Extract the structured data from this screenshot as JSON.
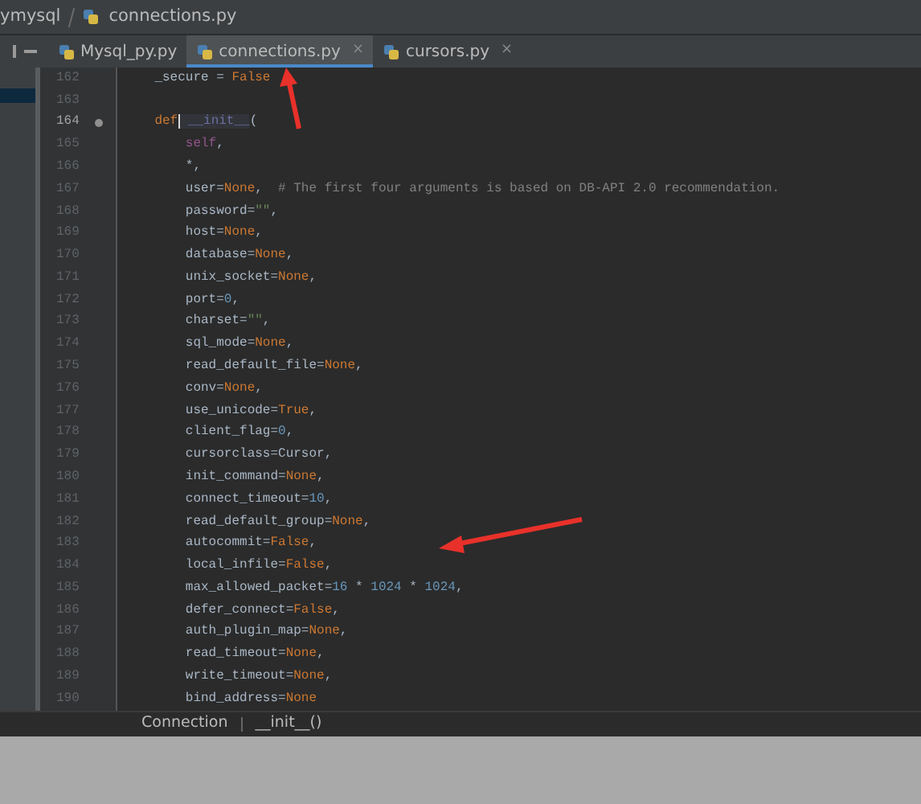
{
  "breadcrumb": [
    {
      "label": "ymysql",
      "kind": "package"
    },
    {
      "label": "connections.py",
      "kind": "file"
    }
  ],
  "tabs": [
    {
      "label": "Mysql_py.py",
      "selected": false
    },
    {
      "label": "connections.py",
      "selected": true,
      "close_glyph": "×"
    },
    {
      "label": "cursors.py",
      "selected": false,
      "close_glyph": "×"
    }
  ],
  "code_lines": [
    {
      "number": "162",
      "current": false,
      "segments": [
        {
          "text": "    _secure = ",
          "kind": "plain"
        },
        {
          "text": "False",
          "kind": "keyword"
        }
      ]
    },
    {
      "number": "163",
      "current": false
    },
    {
      "number": "164",
      "current": true,
      "caret": true,
      "segments": [
        {
          "text": "    def",
          "kind": "keyword"
        },
        {
          "text": " __init__",
          "kind": "function"
        },
        {
          "text": "(",
          "kind": "plain"
        }
      ]
    },
    {
      "number": "165",
      "current": false,
      "segments": [
        {
          "text": "        self",
          "kind": "self"
        },
        {
          "text": ",",
          "kind": "plain"
        }
      ]
    },
    {
      "number": "166",
      "current": false,
      "segments": [
        {
          "text": "        *,",
          "kind": "plain"
        }
      ]
    },
    {
      "number": "167",
      "current": false,
      "segments": [
        {
          "text": "        user=",
          "kind": "plain"
        },
        {
          "text": "None",
          "kind": "keyword"
        },
        {
          "text": ",  ",
          "kind": "plain"
        },
        {
          "text": "# The first four arguments is based on DB-API 2.0 recommendation.",
          "kind": "comment"
        }
      ]
    },
    {
      "number": "168",
      "current": false,
      "segments": [
        {
          "text": "        password=",
          "kind": "plain"
        },
        {
          "text": "\"\"",
          "kind": "string"
        },
        {
          "text": ",",
          "kind": "plain"
        }
      ]
    },
    {
      "number": "169",
      "current": false,
      "segments": [
        {
          "text": "        host=",
          "kind": "plain"
        },
        {
          "text": "None",
          "kind": "keyword"
        },
        {
          "text": ",",
          "kind": "plain"
        }
      ]
    },
    {
      "number": "170",
      "current": false,
      "segments": [
        {
          "text": "        database=",
          "kind": "plain"
        },
        {
          "text": "None",
          "kind": "keyword"
        },
        {
          "text": ",",
          "kind": "plain"
        }
      ]
    },
    {
      "number": "171",
      "current": false,
      "segments": [
        {
          "text": "        unix_socket=",
          "kind": "plain"
        },
        {
          "text": "None",
          "kind": "keyword"
        },
        {
          "text": ",",
          "kind": "plain"
        }
      ]
    },
    {
      "number": "172",
      "current": false,
      "segments": [
        {
          "text": "        port=",
          "kind": "plain"
        },
        {
          "text": "0",
          "kind": "number"
        },
        {
          "text": ",",
          "kind": "plain"
        }
      ]
    },
    {
      "number": "173",
      "current": false,
      "segments": [
        {
          "text": "        charset=",
          "kind": "plain"
        },
        {
          "text": "\"\"",
          "kind": "string"
        },
        {
          "text": ",",
          "kind": "plain"
        }
      ]
    },
    {
      "number": "174",
      "current": false,
      "segments": [
        {
          "text": "        sql_mode=",
          "kind": "plain"
        },
        {
          "text": "None",
          "kind": "keyword"
        },
        {
          "text": ",",
          "kind": "plain"
        }
      ]
    },
    {
      "number": "175",
      "current": false,
      "segments": [
        {
          "text": "        read_default_file=",
          "kind": "plain"
        },
        {
          "text": "None",
          "kind": "keyword"
        },
        {
          "text": ",",
          "kind": "plain"
        }
      ]
    },
    {
      "number": "176",
      "current": false,
      "segments": [
        {
          "text": "        conv=",
          "kind": "plain"
        },
        {
          "text": "None",
          "kind": "keyword"
        },
        {
          "text": ",",
          "kind": "plain"
        }
      ]
    },
    {
      "number": "177",
      "current": false,
      "segments": [
        {
          "text": "        use_unicode=",
          "kind": "plain"
        },
        {
          "text": "True",
          "kind": "keyword"
        },
        {
          "text": ",",
          "kind": "plain"
        }
      ]
    },
    {
      "number": "178",
      "current": false,
      "segments": [
        {
          "text": "        client_flag=",
          "kind": "plain"
        },
        {
          "text": "0",
          "kind": "number"
        },
        {
          "text": ",",
          "kind": "plain"
        }
      ]
    },
    {
      "number": "179",
      "current": false,
      "segments": [
        {
          "text": "        cursorclass=Cursor,",
          "kind": "plain"
        }
      ]
    },
    {
      "number": "180",
      "current": false,
      "segments": [
        {
          "text": "        init_command=",
          "kind": "plain"
        },
        {
          "text": "None",
          "kind": "keyword"
        },
        {
          "text": ",",
          "kind": "plain"
        }
      ]
    },
    {
      "number": "181",
      "current": false,
      "segments": [
        {
          "text": "        connect_timeout=",
          "kind": "plain"
        },
        {
          "text": "10",
          "kind": "number"
        },
        {
          "text": ",",
          "kind": "plain"
        }
      ]
    },
    {
      "number": "182",
      "current": false,
      "segments": [
        {
          "text": "        read_default_group=",
          "kind": "plain"
        },
        {
          "text": "None",
          "kind": "keyword"
        },
        {
          "text": ",",
          "kind": "plain"
        }
      ]
    },
    {
      "number": "183",
      "current": false,
      "segments": [
        {
          "text": "        autocommit=",
          "kind": "plain"
        },
        {
          "text": "False",
          "kind": "keyword"
        },
        {
          "text": ",",
          "kind": "plain"
        }
      ]
    },
    {
      "number": "184",
      "current": false,
      "segments": [
        {
          "text": "        local_infile=",
          "kind": "plain"
        },
        {
          "text": "False",
          "kind": "keyword"
        },
        {
          "text": ",",
          "kind": "plain"
        }
      ]
    },
    {
      "number": "185",
      "current": false,
      "segments": [
        {
          "text": "        max_allowed_packet=",
          "kind": "plain"
        },
        {
          "text": "16",
          "kind": "number"
        },
        {
          "text": " * ",
          "kind": "plain"
        },
        {
          "text": "1024",
          "kind": "number"
        },
        {
          "text": " * ",
          "kind": "plain"
        },
        {
          "text": "1024",
          "kind": "number"
        },
        {
          "text": ",",
          "kind": "plain"
        }
      ]
    },
    {
      "number": "186",
      "current": false,
      "segments": [
        {
          "text": "        defer_connect=",
          "kind": "plain"
        },
        {
          "text": "False",
          "kind": "keyword"
        },
        {
          "text": ",",
          "kind": "plain"
        }
      ]
    },
    {
      "number": "187",
      "current": false,
      "segments": [
        {
          "text": "        auth_plugin_map=",
          "kind": "plain"
        },
        {
          "text": "None",
          "kind": "keyword"
        },
        {
          "text": ",",
          "kind": "plain"
        }
      ]
    },
    {
      "number": "188",
      "current": false,
      "segments": [
        {
          "text": "        read_timeout=",
          "kind": "plain"
        },
        {
          "text": "None",
          "kind": "keyword"
        },
        {
          "text": ",",
          "kind": "plain"
        }
      ]
    },
    {
      "number": "189",
      "current": false,
      "segments": [
        {
          "text": "        write_timeout=",
          "kind": "plain"
        },
        {
          "text": "None",
          "kind": "keyword"
        },
        {
          "text": ",",
          "kind": "plain"
        }
      ]
    },
    {
      "number": "190",
      "current": false,
      "segments": [
        {
          "text": "        bind_address=",
          "kind": "plain"
        },
        {
          "text": "None",
          "kind": "keyword"
        }
      ]
    }
  ],
  "status_breadcrumb": [
    "Connection",
    "__init__()"
  ]
}
